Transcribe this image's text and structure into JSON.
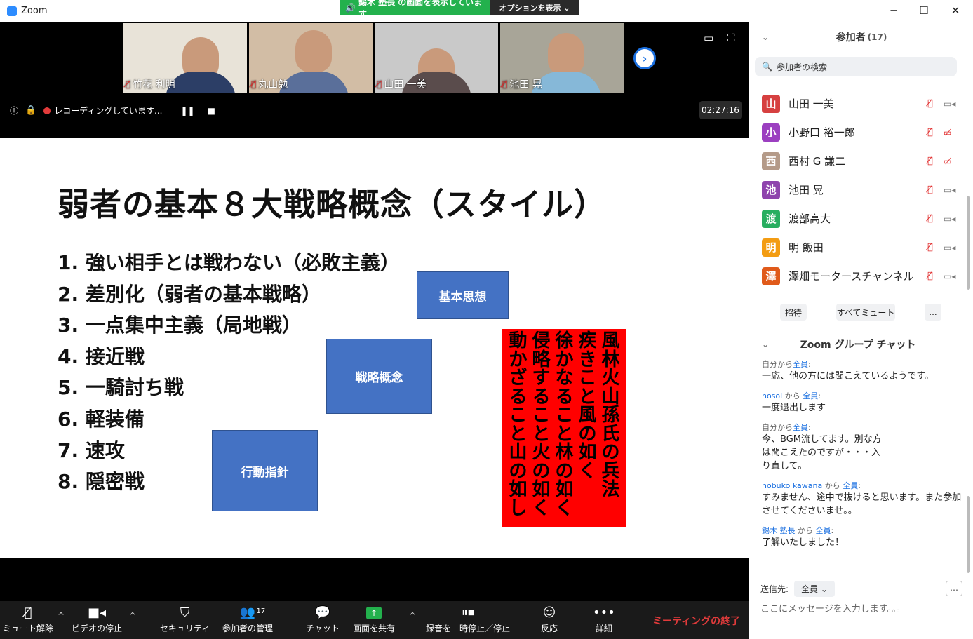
{
  "window": {
    "app_title": "Zoom",
    "min": "─",
    "max": "☐",
    "close": "✕"
  },
  "share_banner": {
    "text": "錫木 塾長 の画面を表示しています",
    "options": "オプションを表示 ⌄"
  },
  "video": {
    "thumbnails": [
      {
        "name": "竹花 利明",
        "bg": "#e8e3d8",
        "body_color": "#2c3e66"
      },
      {
        "name": "丸山勉",
        "bg": "#d2bda5",
        "body_color": "#5a6f9a"
      },
      {
        "name": "山田 一美",
        "bg": "#c9c9c9",
        "body_color": "#5a4c4c"
      },
      {
        "name": "池田 晃",
        "bg": "#a8a598",
        "body_color": "#86b8d8"
      }
    ],
    "next_arrow": "›",
    "recording_text": "レコーディングしています...",
    "pause_sym": "❚❚",
    "stop_sym": "■",
    "timer": "02:27:16"
  },
  "slide": {
    "title": "弱者の基本８大戦略概念（スタイル）",
    "items": [
      "1. 強い相手とは戦わない（必敗主義）",
      "2. 差別化（弱者の基本戦略）",
      "3. 一点集中主義（局地戦）",
      "4. 接近戦",
      "5. 一騎討ち戦",
      "6. 軽装備",
      "7. 速攻",
      "8. 隠密戦"
    ],
    "box_basic": "基本思想",
    "box_strategy": "戦略概念",
    "box_action": "行動指針",
    "red_columns": [
      "風林火山　孫氏の兵法",
      "疾きこと風の如く",
      "徐かなること林の如く",
      "侵略すること火の如く",
      "動かざること山の如し"
    ]
  },
  "toolbar": {
    "mute": "ミュート解除",
    "video": "ビデオの停止",
    "security": "セキュリティ",
    "participants": "参加者の管理",
    "participants_count": "17",
    "chat": "チャット",
    "share": "画面を共有",
    "record": "録音を一時停止／停止",
    "reactions": "反応",
    "more": "詳細",
    "end": "ミーティングの終了"
  },
  "participants_panel": {
    "title": "参加者",
    "count": "(17)",
    "search_placeholder": "参加者の検索",
    "people": [
      {
        "initial": "山",
        "name": "山田 一美",
        "color": "#d64040",
        "cam_off": false
      },
      {
        "initial": "小",
        "name": "小野口 裕一郎",
        "color": "#9b3fc0",
        "cam_off": true
      },
      {
        "initial": "西",
        "name": "西村 G 謙二",
        "color": "#b49a88",
        "cam_off": true
      },
      {
        "initial": "池",
        "name": "池田 晃",
        "color": "#8e44ad",
        "cam_off": false
      },
      {
        "initial": "渡",
        "name": "渡部高大",
        "color": "#27ae60",
        "cam_off": false
      },
      {
        "initial": "明",
        "name": "明 飯田",
        "color": "#f39c12",
        "cam_off": false
      },
      {
        "initial": "澤",
        "name": "澤畑モータースチャンネル",
        "color": "#e05a1a",
        "cam_off": false
      }
    ],
    "invite": "招待",
    "mute_all": "すべてミュート",
    "more": "..."
  },
  "chat_panel": {
    "title": "Zoom グループ チャット",
    "messages": [
      {
        "from": "自分",
        "to": "全員",
        "text": "一応、他の方には聞こえているようです。"
      },
      {
        "from": "hosoi",
        "to": "全員",
        "text": "一度退出します"
      },
      {
        "from": "自分",
        "to": "全員",
        "text": "今、BGM流してます。別な方は聞こえたのですが・・・入り直して。"
      },
      {
        "from": "nobuko kawana",
        "to": "全員",
        "text": "すみません、途中で抜けると思います。また参加させてくださいませ。。"
      },
      {
        "from": "錫木 塾長",
        "to": "全員",
        "text": "了解いたしました！"
      }
    ],
    "send_to_label": "送信先:",
    "send_to_value": "全員 ⌄",
    "input_placeholder": "ここにメッセージを入力します。。。",
    "more_btn": "…"
  }
}
